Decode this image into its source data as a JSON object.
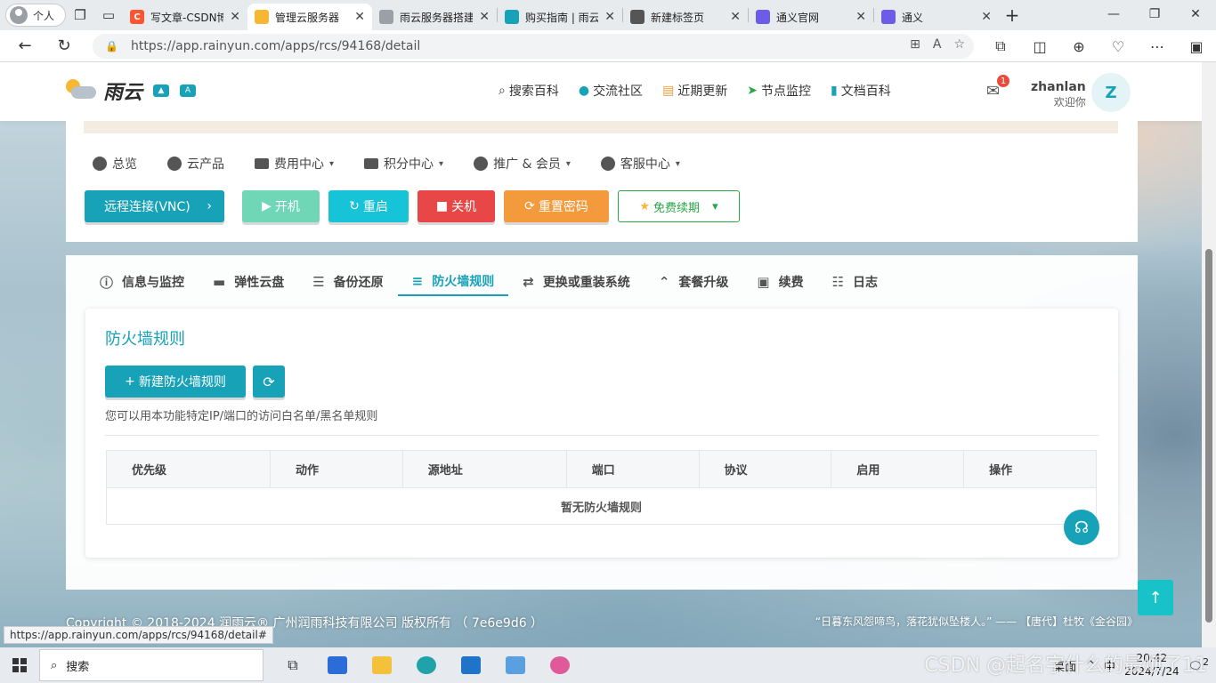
{
  "browser": {
    "profile_label": "个人",
    "tabs": [
      {
        "title": "写文章-CSDN博客",
        "fav_color": "#fc5531",
        "fav_text": "C"
      },
      {
        "title": "管理云服务器",
        "fav_color": "#f7b733",
        "fav_text": ""
      },
      {
        "title": "雨云服务器搭建",
        "fav_color": "#9aa0a6",
        "fav_text": ""
      },
      {
        "title": "购买指南 | 雨云",
        "fav_color": "#17a2b8",
        "fav_text": ""
      },
      {
        "title": "新建标签页",
        "fav_color": "#555555",
        "fav_text": ""
      },
      {
        "title": "通义官网",
        "fav_color": "#6c5ce7",
        "fav_text": ""
      },
      {
        "title": "通义",
        "fav_color": "#6c5ce7",
        "fav_text": ""
      }
    ],
    "url": "https://app.rainyun.com/apps/rcs/94168/detail",
    "status_url": "https://app.rainyun.com/apps/rcs/94168/detail#"
  },
  "header": {
    "logo_text": "雨云",
    "nav": [
      {
        "icon": "search-icon",
        "label": "搜索百科"
      },
      {
        "icon": "qq-icon",
        "label": "交流社区"
      },
      {
        "icon": "news-icon",
        "label": "近期更新"
      },
      {
        "icon": "send-icon",
        "label": "节点监控"
      },
      {
        "icon": "book-icon",
        "label": "文档百科"
      }
    ],
    "mail_badge": "1",
    "username": "zhanlan",
    "welcome": "欢迎你",
    "avatar_letter": "Z"
  },
  "menu": [
    {
      "label": "总览",
      "has_dropdown": false
    },
    {
      "label": "云产品",
      "has_dropdown": false
    },
    {
      "label": "费用中心",
      "has_dropdown": true
    },
    {
      "label": "积分中心",
      "has_dropdown": true
    },
    {
      "label": "推广 & 会员",
      "has_dropdown": true
    },
    {
      "label": "客服中心",
      "has_dropdown": true
    }
  ],
  "actions": {
    "vnc": "远程连接(VNC)",
    "power_on": "开机",
    "reboot": "重启",
    "shutdown": "关机",
    "reset_password": "重置密码",
    "free_renew": "免费续期"
  },
  "tabs": [
    {
      "label": "信息与监控",
      "active": false
    },
    {
      "label": "弹性云盘",
      "active": false
    },
    {
      "label": "备份还原",
      "active": false
    },
    {
      "label": "防火墙规则",
      "active": true
    },
    {
      "label": "更换或重装系统",
      "active": false
    },
    {
      "label": "套餐升级",
      "active": false
    },
    {
      "label": "续费",
      "active": false
    },
    {
      "label": "日志",
      "active": false
    }
  ],
  "firewall": {
    "title": "防火墙规则",
    "add_button": "新建防火墙规则",
    "description": "您可以用本功能特定IP/端口的访问白名单/黑名单规则",
    "columns": [
      "优先级",
      "动作",
      "源地址",
      "端口",
      "协议",
      "启用",
      "操作"
    ],
    "empty_text": "暂无防火墙规则"
  },
  "footer": {
    "copyright": "Copyright © 2018-2024 润雨云® 广州润雨科技有限公司 版权所有 （ 7e6e9d6 ）",
    "quote": "“日暮东风怨啼鸟，落花犹似坠楼人。” —— 【唐代】杜牧《金谷园》"
  },
  "taskbar": {
    "search_label": "搜索",
    "desktop_label": "桌面",
    "ime": "中",
    "time": "20:42",
    "date": "2024/7/24",
    "notif_count": "2",
    "watermark": "CSDN @起名字什么的最烦了11"
  },
  "colors": {
    "accent": "#17a2b8",
    "danger": "#e84747",
    "warning": "#f39a3c",
    "success": "#28a745"
  }
}
